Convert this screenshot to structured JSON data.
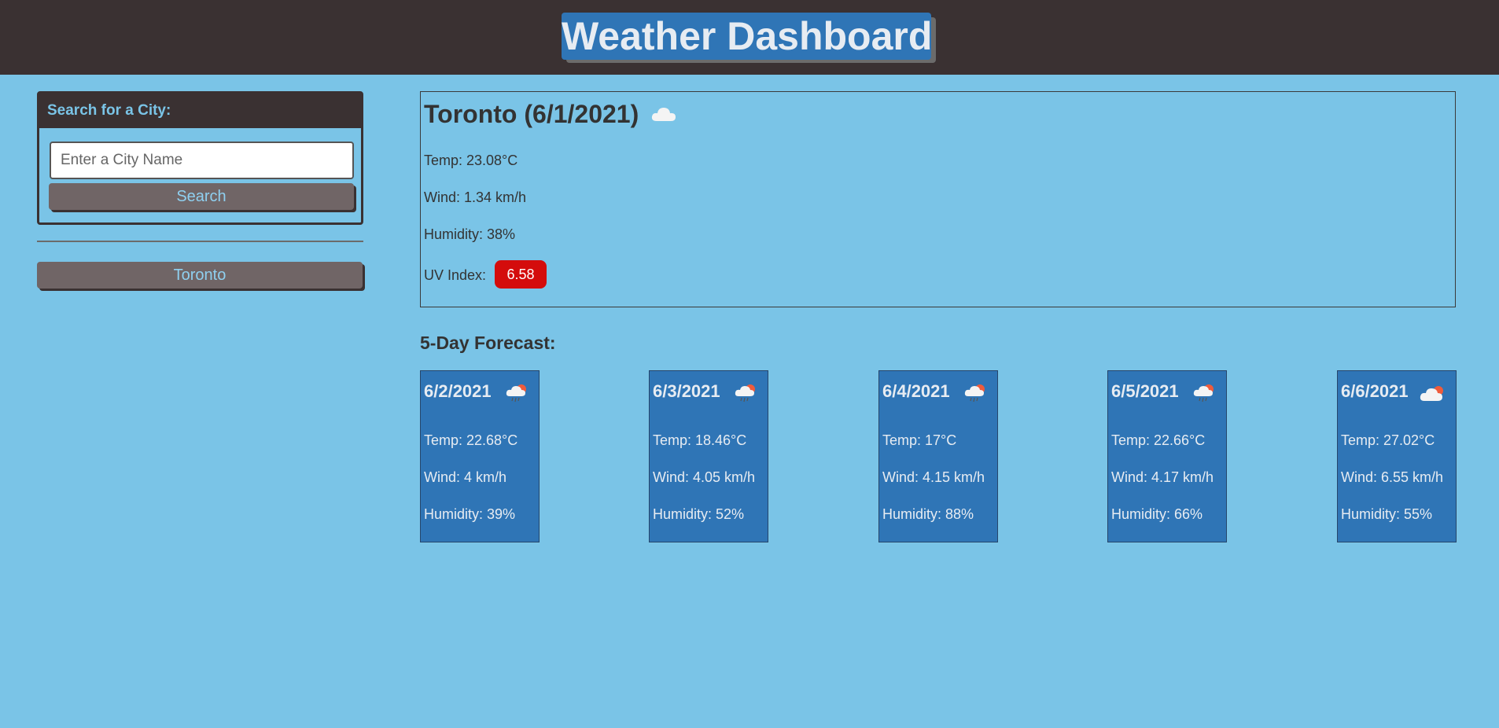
{
  "header": {
    "title": "Weather Dashboard"
  },
  "sidebar": {
    "search_heading": "Search for a City:",
    "search_placeholder": "Enter a City Name",
    "search_button": "Search",
    "history": [
      "Toronto"
    ]
  },
  "current": {
    "title": "Toronto (6/1/2021)",
    "icon": "cloud-icon",
    "temp": "Temp: 23.08°C",
    "wind": "Wind: 1.34 km/h",
    "humidity": "Humidity: 38%",
    "uv_label": "UV Index:",
    "uv_value": "6.58",
    "uv_color": "#d40c0c"
  },
  "forecast": {
    "title": "5-Day Forecast:",
    "days": [
      {
        "date": "6/2/2021",
        "icon": "rain-sun-icon",
        "temp": "Temp: 22.68°C",
        "wind": "Wind: 4 km/h",
        "humidity": "Humidity: 39%"
      },
      {
        "date": "6/3/2021",
        "icon": "rain-sun-icon",
        "temp": "Temp: 18.46°C",
        "wind": "Wind: 4.05 km/h",
        "humidity": "Humidity: 52%"
      },
      {
        "date": "6/4/2021",
        "icon": "rain-sun-icon",
        "temp": "Temp: 17°C",
        "wind": "Wind: 4.15 km/h",
        "humidity": "Humidity: 88%"
      },
      {
        "date": "6/5/2021",
        "icon": "rain-sun-icon",
        "temp": "Temp: 22.66°C",
        "wind": "Wind: 4.17 km/h",
        "humidity": "Humidity: 66%"
      },
      {
        "date": "6/6/2021",
        "icon": "cloud-sun-icon",
        "temp": "Temp: 27.02°C",
        "wind": "Wind: 6.55 km/h",
        "humidity": "Humidity: 55%"
      }
    ]
  },
  "colors": {
    "background": "#7ac4e7",
    "header": "#3a3132",
    "accent": "#2f75b6",
    "button": "#706566"
  }
}
